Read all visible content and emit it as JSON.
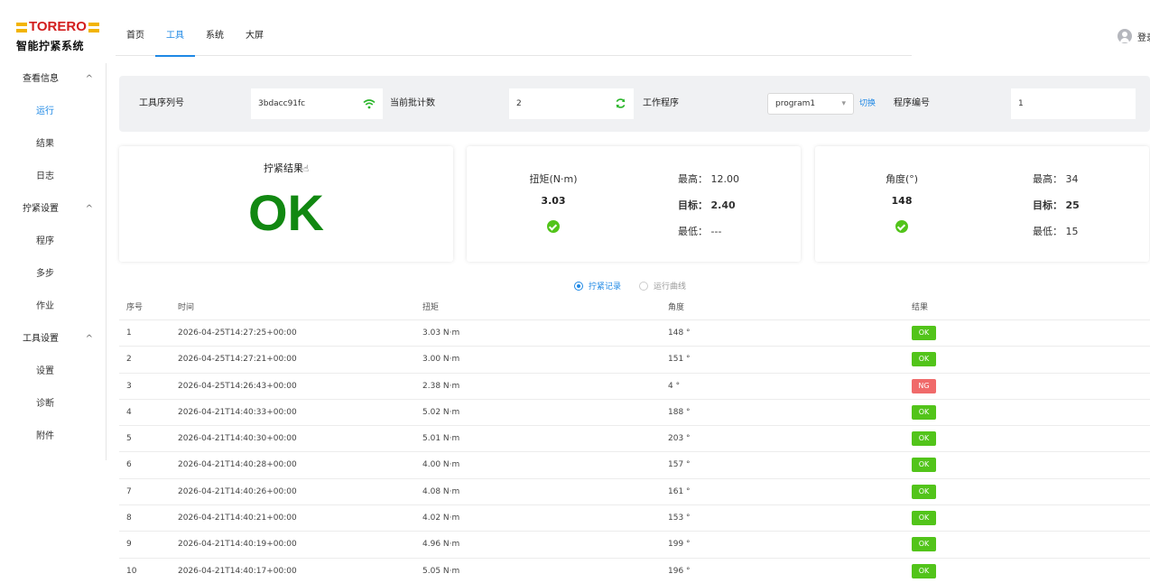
{
  "app": {
    "brand": "TORERO",
    "subtitle": "智能拧紧系统",
    "colors": {
      "accent": "#1e88e5",
      "ok": "#52c41a",
      "ng": "#f06a6a",
      "ok_text": "#118811",
      "brand_red": "#d21e1e",
      "brand_yellow": "#f2b400"
    }
  },
  "nav": {
    "tabs": [
      {
        "label": "首页"
      },
      {
        "label": "工具",
        "active": true
      },
      {
        "label": "系统"
      },
      {
        "label": "大屏"
      }
    ],
    "user_label": "登录"
  },
  "sidebar": {
    "groups": [
      {
        "label": "查看信息",
        "chev": "^",
        "items": [
          "运行",
          "结果",
          "日志"
        ]
      },
      {
        "label": "拧紧设置",
        "chev": "^",
        "items": [
          "程序",
          "多步",
          "作业"
        ]
      },
      {
        "label": "工具设置",
        "chev": "^",
        "items": [
          "设置",
          "诊断",
          "附件"
        ]
      }
    ],
    "active_item": "运行"
  },
  "info": {
    "serial_label": "工具序列号",
    "serial_value": "3bdacc91fc",
    "batch_label": "当前批计数",
    "batch_value": "2",
    "program_label": "工作程序",
    "program_value": "program1",
    "switch_label": "切换",
    "program_no_label": "程序编号",
    "program_no_value": "1"
  },
  "result_card": {
    "title": "拧紧结果",
    "value": "OK"
  },
  "torque_card": {
    "label": "扭矩(N·m)",
    "value": "3.03",
    "max_label": "最高：",
    "max_value": "12.00",
    "target_label": "目标：",
    "target_value": "2.40",
    "min_label": "最低：",
    "min_value": "---"
  },
  "angle_card": {
    "label": "角度(°)",
    "value": "148",
    "max_label": "最高：",
    "max_value": "34",
    "target_label": "目标：",
    "target_value": "25",
    "min_label": "最低：",
    "min_value": "15"
  },
  "view": {
    "records_label": "拧紧记录",
    "curve_label": "运行曲线"
  },
  "table": {
    "headers": [
      "序号",
      "时间",
      "扭矩",
      "角度",
      "结果"
    ],
    "rows": [
      [
        "1",
        "2026-04-25T14:27:25+00:00",
        "3.03 N·m",
        "148 °",
        "OK"
      ],
      [
        "2",
        "2026-04-25T14:27:21+00:00",
        "3.00 N·m",
        "151 °",
        "OK"
      ],
      [
        "3",
        "2026-04-25T14:26:43+00:00",
        "2.38 N·m",
        "4 °",
        "NG"
      ],
      [
        "4",
        "2026-04-21T14:40:33+00:00",
        "5.02 N·m",
        "188 °",
        "OK"
      ],
      [
        "5",
        "2026-04-21T14:40:30+00:00",
        "5.01 N·m",
        "203 °",
        "OK"
      ],
      [
        "6",
        "2026-04-21T14:40:28+00:00",
        "4.00 N·m",
        "157 °",
        "OK"
      ],
      [
        "7",
        "2026-04-21T14:40:26+00:00",
        "4.08 N·m",
        "161 °",
        "OK"
      ],
      [
        "8",
        "2026-04-21T14:40:21+00:00",
        "4.02 N·m",
        "153 °",
        "OK"
      ],
      [
        "9",
        "2026-04-21T14:40:19+00:00",
        "4.96 N·m",
        "199 °",
        "OK"
      ],
      [
        "10",
        "2026-04-21T14:40:17+00:00",
        "5.05 N·m",
        "196 °",
        "OK"
      ]
    ]
  }
}
